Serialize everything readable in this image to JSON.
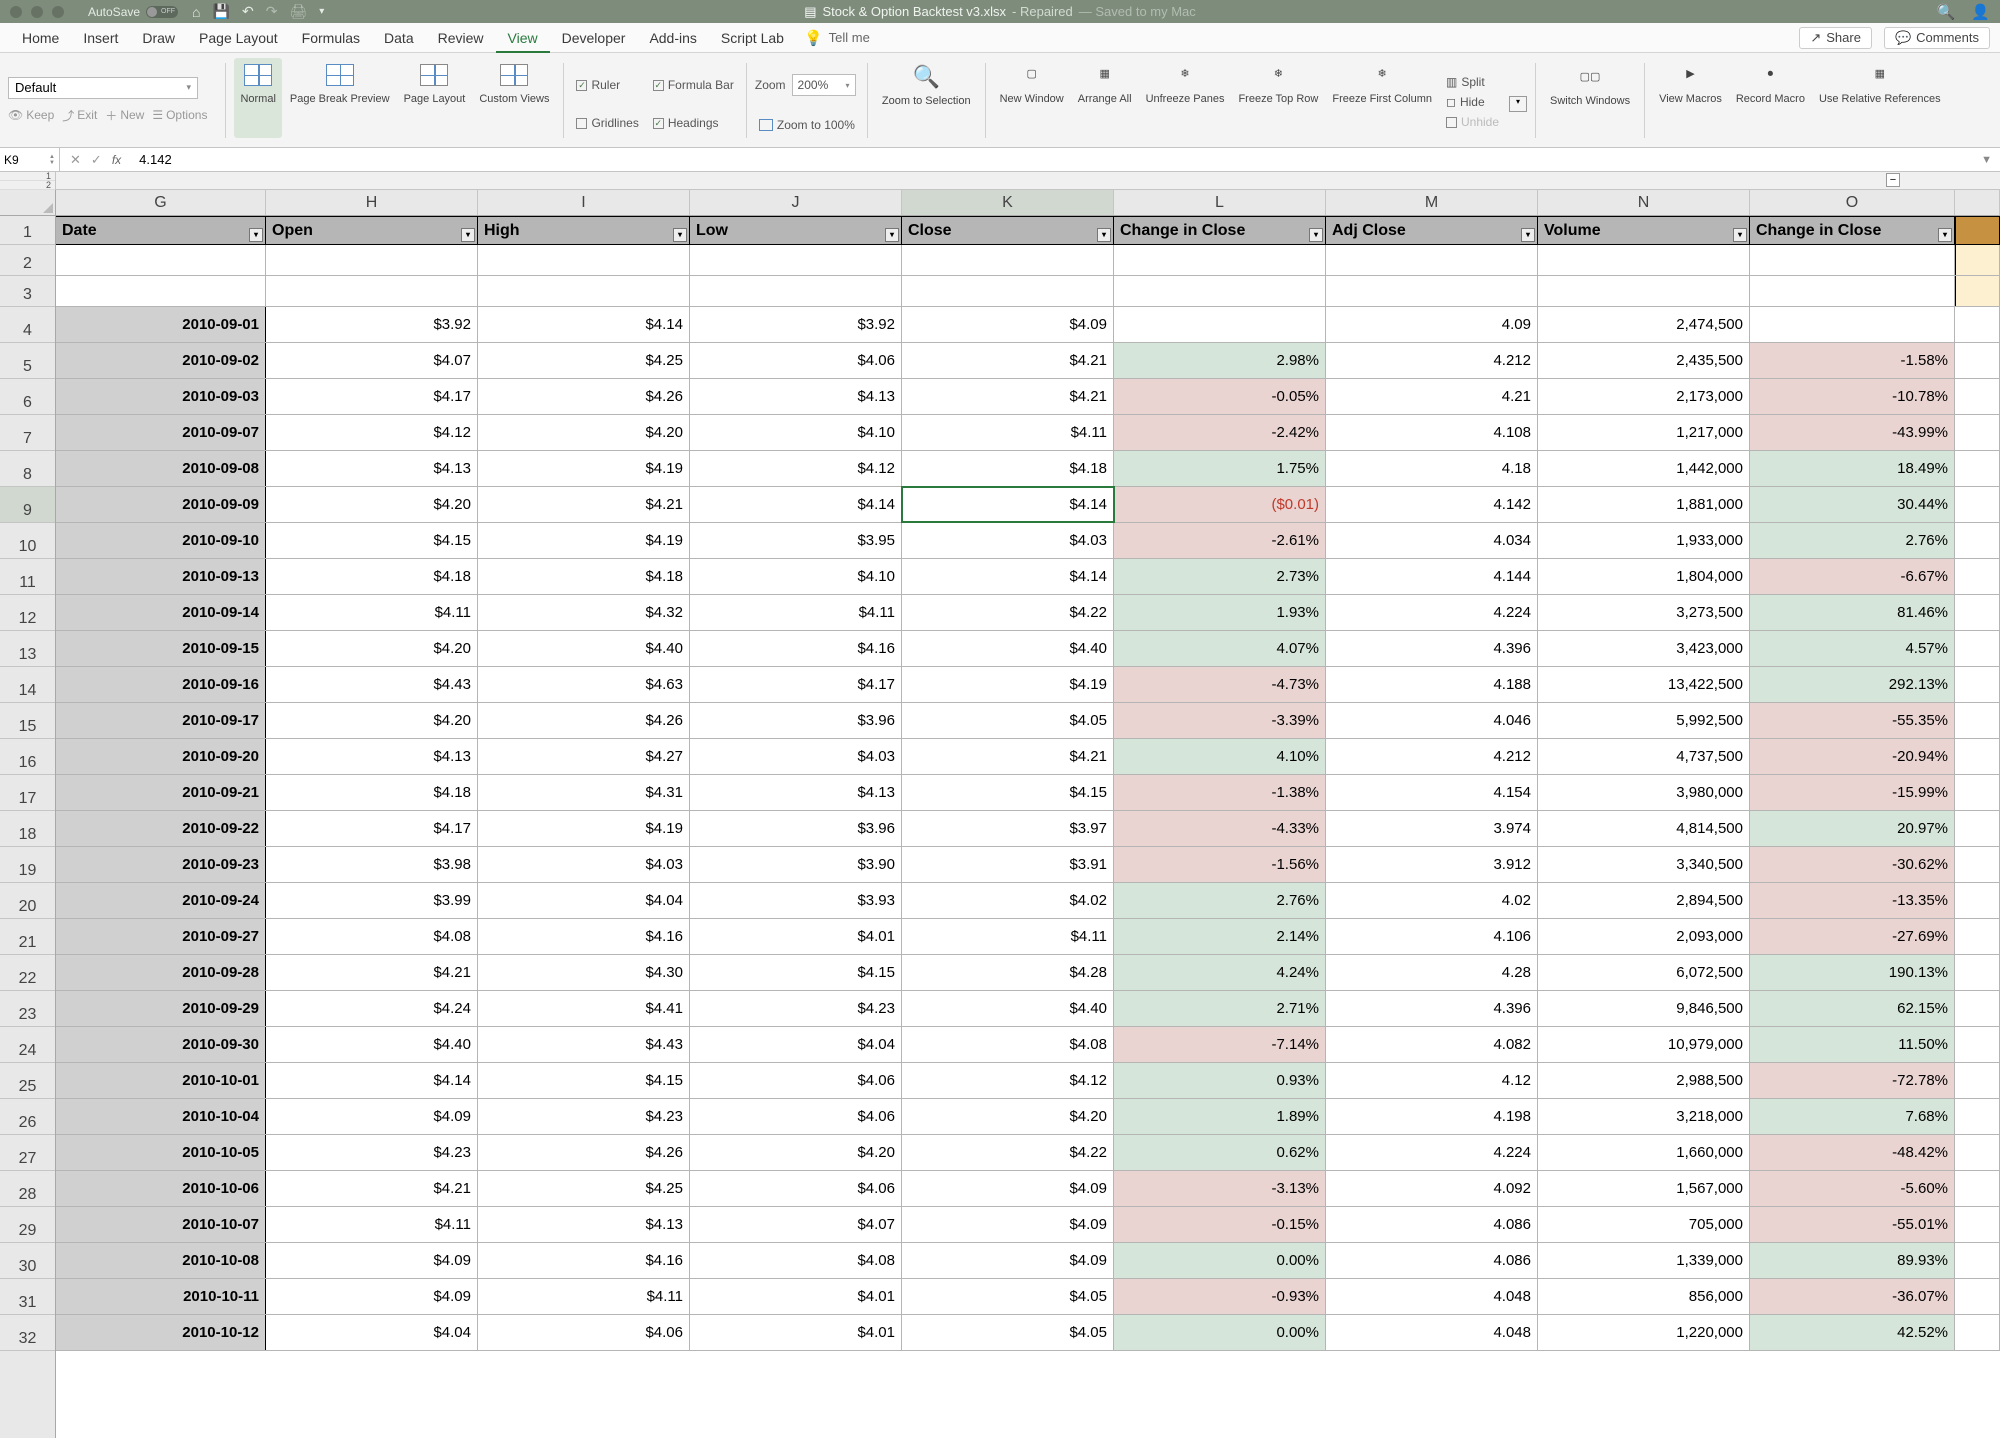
{
  "titlebar": {
    "autosave_label": "AutoSave",
    "filename": "Stock & Option Backtest v3.xlsx",
    "repaired": "- Repaired",
    "saved": "— Saved to my Mac"
  },
  "tabs": [
    "Home",
    "Insert",
    "Draw",
    "Page Layout",
    "Formulas",
    "Data",
    "Review",
    "View",
    "Developer",
    "Add-ins",
    "Script Lab"
  ],
  "active_tab": "View",
  "tellme": "Tell me",
  "share": "Share",
  "comments": "Comments",
  "ribbon": {
    "namebox_text": "Default",
    "keep": "Keep",
    "exit": "Exit",
    "new": "New",
    "options": "Options",
    "normal": "Normal",
    "page_break": "Page Break Preview",
    "page_layout": "Page Layout",
    "custom_views": "Custom Views",
    "ruler": "Ruler",
    "formula_bar": "Formula Bar",
    "gridlines": "Gridlines",
    "headings": "Headings",
    "zoom_label": "Zoom",
    "zoom_value": "200%",
    "zoom_100": "Zoom to 100%",
    "zoom_selection": "Zoom to Selection",
    "new_window": "New Window",
    "arrange_all": "Arrange All",
    "unfreeze": "Unfreeze Panes",
    "freeze_top": "Freeze Top Row",
    "freeze_first": "Freeze First Column",
    "split": "Split",
    "hide": "Hide",
    "unhide": "Unhide",
    "switch_windows": "Switch Windows",
    "view_macros": "View Macros",
    "record_macro": "Record Macro",
    "use_relative": "Use Relative References"
  },
  "formula_bar": {
    "cell_ref": "K9",
    "value": "4.142"
  },
  "col_letters": [
    "G",
    "H",
    "I",
    "J",
    "K",
    "L",
    "M",
    "N",
    "O"
  ],
  "headers": [
    "Date",
    "Open",
    "High",
    "Low",
    "Close",
    "Change in Close",
    "Adj Close",
    "Volume",
    "Change in Close"
  ],
  "row_heights": {
    "header": 29,
    "blank": 31,
    "data": 36
  },
  "active_cell": {
    "row": 9,
    "col": "K"
  },
  "rows": [
    {
      "n": 4,
      "date": "2010-09-01",
      "open": "$3.92",
      "high": "$4.14",
      "low": "$3.92",
      "close": "$4.09",
      "chg": "",
      "chgc": "",
      "adj": "4.09",
      "vol": "2,474,500",
      "chg2": "",
      "chg2c": ""
    },
    {
      "n": 5,
      "date": "2010-09-02",
      "open": "$4.07",
      "high": "$4.25",
      "low": "$4.06",
      "close": "$4.21",
      "chg": "2.98%",
      "chgc": "green",
      "adj": "4.212",
      "vol": "2,435,500",
      "chg2": "-1.58%",
      "chg2c": "red"
    },
    {
      "n": 6,
      "date": "2010-09-03",
      "open": "$4.17",
      "high": "$4.26",
      "low": "$4.13",
      "close": "$4.21",
      "chg": "-0.05%",
      "chgc": "red",
      "adj": "4.21",
      "vol": "2,173,000",
      "chg2": "-10.78%",
      "chg2c": "red"
    },
    {
      "n": 7,
      "date": "2010-09-07",
      "open": "$4.12",
      "high": "$4.20",
      "low": "$4.10",
      "close": "$4.11",
      "chg": "-2.42%",
      "chgc": "red",
      "adj": "4.108",
      "vol": "1,217,000",
      "chg2": "-43.99%",
      "chg2c": "red"
    },
    {
      "n": 8,
      "date": "2010-09-08",
      "open": "$4.13",
      "high": "$4.19",
      "low": "$4.12",
      "close": "$4.18",
      "chg": "1.75%",
      "chgc": "green",
      "adj": "4.18",
      "vol": "1,442,000",
      "chg2": "18.49%",
      "chg2c": "green"
    },
    {
      "n": 9,
      "date": "2010-09-09",
      "open": "$4.20",
      "high": "$4.21",
      "low": "$4.14",
      "close": "$4.14",
      "chg": "($0.01)",
      "chgc": "red",
      "chgneg": true,
      "adj": "4.142",
      "vol": "1,881,000",
      "chg2": "30.44%",
      "chg2c": "green"
    },
    {
      "n": 10,
      "date": "2010-09-10",
      "open": "$4.15",
      "high": "$4.19",
      "low": "$3.95",
      "close": "$4.03",
      "chg": "-2.61%",
      "chgc": "red",
      "adj": "4.034",
      "vol": "1,933,000",
      "chg2": "2.76%",
      "chg2c": "green"
    },
    {
      "n": 11,
      "date": "2010-09-13",
      "open": "$4.18",
      "high": "$4.18",
      "low": "$4.10",
      "close": "$4.14",
      "chg": "2.73%",
      "chgc": "green",
      "adj": "4.144",
      "vol": "1,804,000",
      "chg2": "-6.67%",
      "chg2c": "red"
    },
    {
      "n": 12,
      "date": "2010-09-14",
      "open": "$4.11",
      "high": "$4.32",
      "low": "$4.11",
      "close": "$4.22",
      "chg": "1.93%",
      "chgc": "green",
      "adj": "4.224",
      "vol": "3,273,500",
      "chg2": "81.46%",
      "chg2c": "green"
    },
    {
      "n": 13,
      "date": "2010-09-15",
      "open": "$4.20",
      "high": "$4.40",
      "low": "$4.16",
      "close": "$4.40",
      "chg": "4.07%",
      "chgc": "green",
      "adj": "4.396",
      "vol": "3,423,000",
      "chg2": "4.57%",
      "chg2c": "green"
    },
    {
      "n": 14,
      "date": "2010-09-16",
      "open": "$4.43",
      "high": "$4.63",
      "low": "$4.17",
      "close": "$4.19",
      "chg": "-4.73%",
      "chgc": "red",
      "adj": "4.188",
      "vol": "13,422,500",
      "chg2": "292.13%",
      "chg2c": "green"
    },
    {
      "n": 15,
      "date": "2010-09-17",
      "open": "$4.20",
      "high": "$4.26",
      "low": "$3.96",
      "close": "$4.05",
      "chg": "-3.39%",
      "chgc": "red",
      "adj": "4.046",
      "vol": "5,992,500",
      "chg2": "-55.35%",
      "chg2c": "red"
    },
    {
      "n": 16,
      "date": "2010-09-20",
      "open": "$4.13",
      "high": "$4.27",
      "low": "$4.03",
      "close": "$4.21",
      "chg": "4.10%",
      "chgc": "green",
      "adj": "4.212",
      "vol": "4,737,500",
      "chg2": "-20.94%",
      "chg2c": "red"
    },
    {
      "n": 17,
      "date": "2010-09-21",
      "open": "$4.18",
      "high": "$4.31",
      "low": "$4.13",
      "close": "$4.15",
      "chg": "-1.38%",
      "chgc": "red",
      "adj": "4.154",
      "vol": "3,980,000",
      "chg2": "-15.99%",
      "chg2c": "red"
    },
    {
      "n": 18,
      "date": "2010-09-22",
      "open": "$4.17",
      "high": "$4.19",
      "low": "$3.96",
      "close": "$3.97",
      "chg": "-4.33%",
      "chgc": "red",
      "adj": "3.974",
      "vol": "4,814,500",
      "chg2": "20.97%",
      "chg2c": "green"
    },
    {
      "n": 19,
      "date": "2010-09-23",
      "open": "$3.98",
      "high": "$4.03",
      "low": "$3.90",
      "close": "$3.91",
      "chg": "-1.56%",
      "chgc": "red",
      "adj": "3.912",
      "vol": "3,340,500",
      "chg2": "-30.62%",
      "chg2c": "red"
    },
    {
      "n": 20,
      "date": "2010-09-24",
      "open": "$3.99",
      "high": "$4.04",
      "low": "$3.93",
      "close": "$4.02",
      "chg": "2.76%",
      "chgc": "green",
      "adj": "4.02",
      "vol": "2,894,500",
      "chg2": "-13.35%",
      "chg2c": "red"
    },
    {
      "n": 21,
      "date": "2010-09-27",
      "open": "$4.08",
      "high": "$4.16",
      "low": "$4.01",
      "close": "$4.11",
      "chg": "2.14%",
      "chgc": "green",
      "adj": "4.106",
      "vol": "2,093,000",
      "chg2": "-27.69%",
      "chg2c": "red"
    },
    {
      "n": 22,
      "date": "2010-09-28",
      "open": "$4.21",
      "high": "$4.30",
      "low": "$4.15",
      "close": "$4.28",
      "chg": "4.24%",
      "chgc": "green",
      "adj": "4.28",
      "vol": "6,072,500",
      "chg2": "190.13%",
      "chg2c": "green"
    },
    {
      "n": 23,
      "date": "2010-09-29",
      "open": "$4.24",
      "high": "$4.41",
      "low": "$4.23",
      "close": "$4.40",
      "chg": "2.71%",
      "chgc": "green",
      "adj": "4.396",
      "vol": "9,846,500",
      "chg2": "62.15%",
      "chg2c": "green"
    },
    {
      "n": 24,
      "date": "2010-09-30",
      "open": "$4.40",
      "high": "$4.43",
      "low": "$4.04",
      "close": "$4.08",
      "chg": "-7.14%",
      "chgc": "red",
      "adj": "4.082",
      "vol": "10,979,000",
      "chg2": "11.50%",
      "chg2c": "green"
    },
    {
      "n": 25,
      "date": "2010-10-01",
      "open": "$4.14",
      "high": "$4.15",
      "low": "$4.06",
      "close": "$4.12",
      "chg": "0.93%",
      "chgc": "green",
      "adj": "4.12",
      "vol": "2,988,500",
      "chg2": "-72.78%",
      "chg2c": "red"
    },
    {
      "n": 26,
      "date": "2010-10-04",
      "open": "$4.09",
      "high": "$4.23",
      "low": "$4.06",
      "close": "$4.20",
      "chg": "1.89%",
      "chgc": "green",
      "adj": "4.198",
      "vol": "3,218,000",
      "chg2": "7.68%",
      "chg2c": "green"
    },
    {
      "n": 27,
      "date": "2010-10-05",
      "open": "$4.23",
      "high": "$4.26",
      "low": "$4.20",
      "close": "$4.22",
      "chg": "0.62%",
      "chgc": "green",
      "adj": "4.224",
      "vol": "1,660,000",
      "chg2": "-48.42%",
      "chg2c": "red"
    },
    {
      "n": 28,
      "date": "2010-10-06",
      "open": "$4.21",
      "high": "$4.25",
      "low": "$4.06",
      "close": "$4.09",
      "chg": "-3.13%",
      "chgc": "red",
      "adj": "4.092",
      "vol": "1,567,000",
      "chg2": "-5.60%",
      "chg2c": "red"
    },
    {
      "n": 29,
      "date": "2010-10-07",
      "open": "$4.11",
      "high": "$4.13",
      "low": "$4.07",
      "close": "$4.09",
      "chg": "-0.15%",
      "chgc": "red",
      "adj": "4.086",
      "vol": "705,000",
      "chg2": "-55.01%",
      "chg2c": "red"
    },
    {
      "n": 30,
      "date": "2010-10-08",
      "open": "$4.09",
      "high": "$4.16",
      "low": "$4.08",
      "close": "$4.09",
      "chg": "0.00%",
      "chgc": "green",
      "adj": "4.086",
      "vol": "1,339,000",
      "chg2": "89.93%",
      "chg2c": "green"
    },
    {
      "n": 31,
      "date": "2010-10-11",
      "open": "$4.09",
      "high": "$4.11",
      "low": "$4.01",
      "close": "$4.05",
      "chg": "-0.93%",
      "chgc": "red",
      "adj": "4.048",
      "vol": "856,000",
      "chg2": "-36.07%",
      "chg2c": "red"
    },
    {
      "n": 32,
      "date": "2010-10-12",
      "open": "$4.04",
      "high": "$4.06",
      "low": "$4.01",
      "close": "$4.05",
      "chg": "0.00%",
      "chgc": "green",
      "adj": "4.048",
      "vol": "1,220,000",
      "chg2": "42.52%",
      "chg2c": "green"
    }
  ]
}
